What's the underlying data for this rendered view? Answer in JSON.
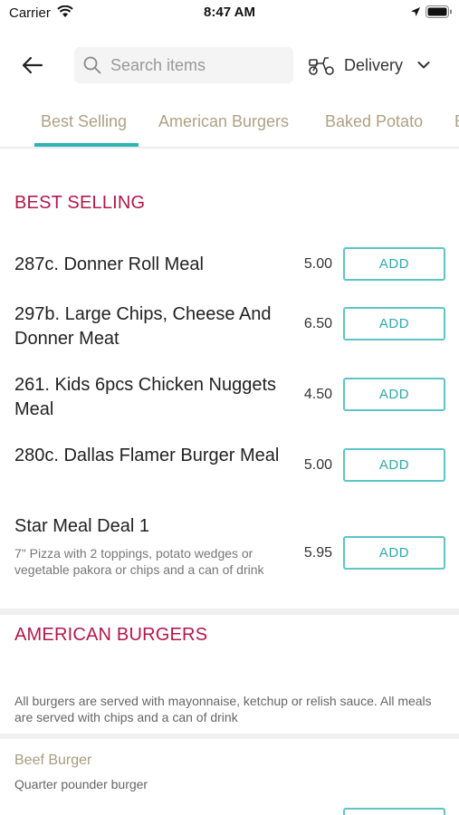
{
  "status_bar": {
    "carrier": "Carrier",
    "time": "8:47 AM"
  },
  "header": {
    "search": {
      "placeholder": "Search items",
      "value": ""
    },
    "delivery_label": "Delivery"
  },
  "tabs": [
    {
      "label": "Best Selling",
      "active": true
    },
    {
      "label": "American Burgers",
      "active": false
    },
    {
      "label": "Baked Potato",
      "active": false
    },
    {
      "label": "B",
      "active": false
    }
  ],
  "sections": [
    {
      "title": "BEST SELLING",
      "items": [
        {
          "name": "287c. Donner Roll Meal",
          "price": "5.00",
          "button": "ADD"
        },
        {
          "name": "297b. Large Chips, Cheese And Donner Meat",
          "price": "6.50",
          "button": "ADD"
        },
        {
          "name": "261. Kids 6pcs Chicken Nuggets Meal",
          "price": "4.50",
          "button": "ADD"
        },
        {
          "name": "280c. Dallas Flamer Burger Meal",
          "price": "5.00",
          "button": "ADD"
        },
        {
          "name": "Star Meal Deal 1",
          "description": "7\" Pizza with 2 toppings, potato wedges or vegetable pakora or chips and a can of drink",
          "price": "5.95",
          "button": "ADD"
        }
      ]
    },
    {
      "title": "AMERICAN BURGERS",
      "note": "All burgers are served with mayonnaise, ketchup or relish sauce. All meals are served with chips and a can of drink",
      "sub_items": [
        {
          "name": "Beef Burger",
          "description": "Quarter pounder burger"
        }
      ]
    }
  ],
  "colors": {
    "accent": "#2fb3b3",
    "section_title": "#b3184a",
    "tab_text": "#b0a184"
  }
}
